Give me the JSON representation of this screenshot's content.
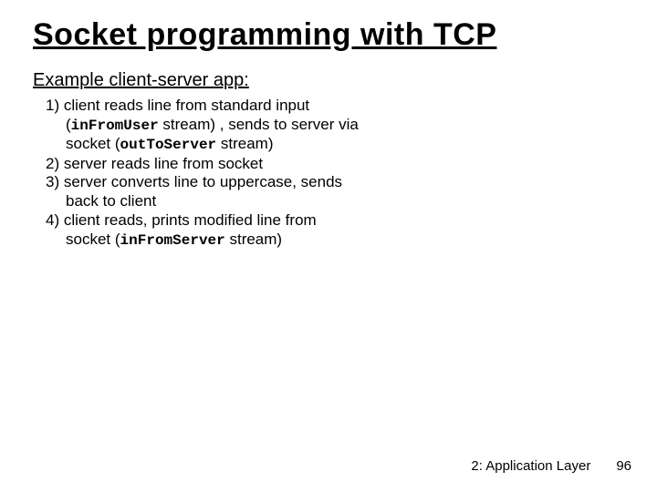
{
  "title": "Socket programming with TCP",
  "subhead": "Example client-server app:",
  "steps": {
    "s1_a": "1) client reads line from standard input (",
    "s1_mono1": "inFromUser",
    "s1_b": " stream) , sends to server via socket (",
    "s1_mono2": "outToServer",
    "s1_c": " stream)",
    "s2": "2) server reads line from socket",
    "s3": "3) server converts line to uppercase, sends back to client",
    "s4_a": "4) client reads, prints  modified line from socket (",
    "s4_mono": "inFromServer",
    "s4_b": " stream)"
  },
  "footer": {
    "chapter": "2: Application Layer",
    "page": "96"
  }
}
